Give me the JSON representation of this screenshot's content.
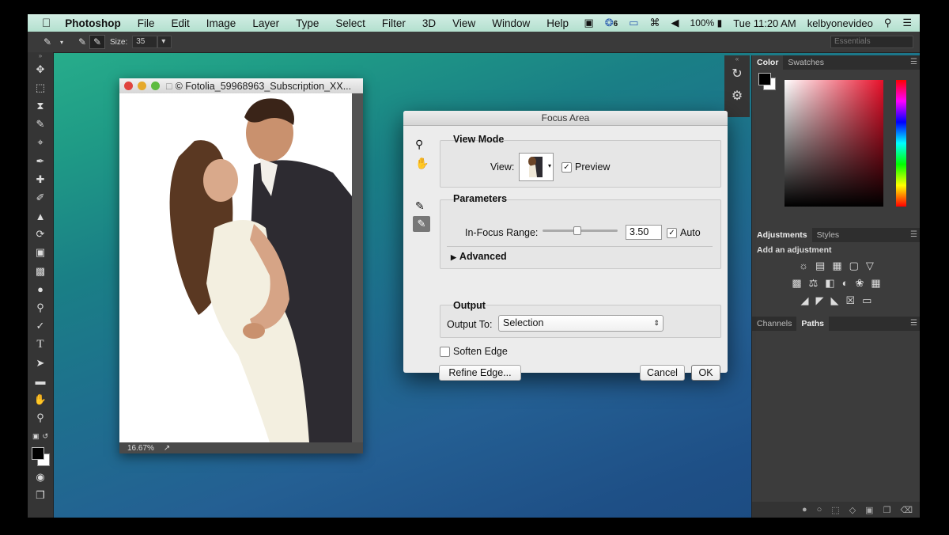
{
  "menubar": {
    "app_name": "Photoshop",
    "items": [
      "File",
      "Edit",
      "Image",
      "Layer",
      "Type",
      "Select",
      "Filter",
      "3D",
      "View",
      "Window",
      "Help"
    ],
    "status": {
      "badge_count": "6",
      "battery": "100%",
      "time": "Tue 11:20 AM",
      "user": "kelbyonevideo"
    }
  },
  "options_bar": {
    "size_label": "Size:",
    "size_value": "35",
    "workspace": "Essentials"
  },
  "document": {
    "title": "© Fotolia_59968963_Subscription_XX...",
    "zoom": "16.67%"
  },
  "dialog": {
    "title": "Focus Area",
    "view_mode": {
      "heading": "View Mode",
      "view_label": "View:",
      "preview_label": "Preview",
      "preview_checked": true
    },
    "parameters": {
      "heading": "Parameters",
      "range_label": "In-Focus Range:",
      "range_value": "3.50",
      "slider_level": 0.45,
      "auto_label": "Auto",
      "auto_checked": true,
      "advanced_label": "Advanced"
    },
    "output": {
      "heading": "Output",
      "output_to_label": "Output To:",
      "output_to_value": "Selection"
    },
    "soften_edge_label": "Soften Edge",
    "soften_edge_checked": false,
    "refine_edge_label": "Refine Edge...",
    "cancel_label": "Cancel",
    "ok_label": "OK"
  },
  "panels": {
    "color_tabs": [
      "Color",
      "Swatches"
    ],
    "adjust_tabs": [
      "Adjustments",
      "Styles"
    ],
    "add_adjustment": "Add an adjustment",
    "paths_tabs": [
      "Channels",
      "Paths"
    ]
  }
}
